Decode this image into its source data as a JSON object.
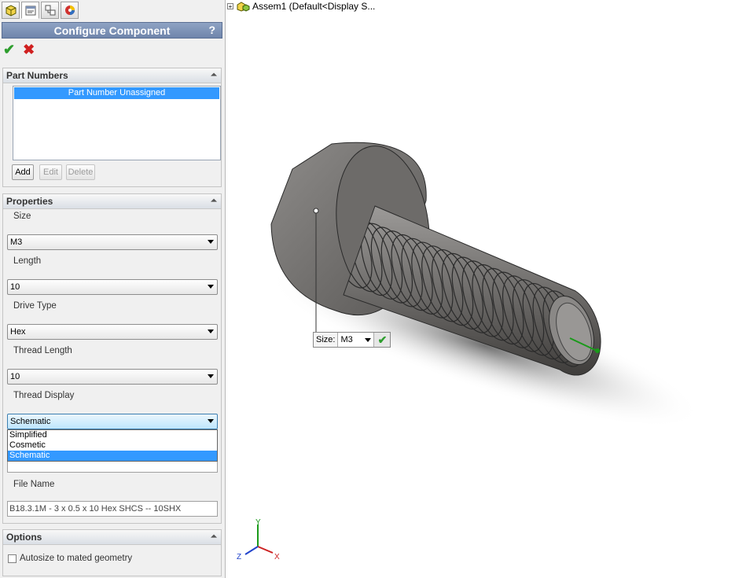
{
  "property_manager": {
    "title": "Configure Component",
    "help": "?",
    "ok_label": "✔",
    "cancel_label": "✖"
  },
  "part_numbers": {
    "header": "Part Numbers",
    "items": [
      "Part Number Unassigned"
    ],
    "add_label": "Add",
    "edit_label": "Edit",
    "delete_label": "Delete"
  },
  "properties": {
    "header": "Properties",
    "size_label": "Size",
    "size_value": "M3",
    "length_label": "Length",
    "length_value": "10",
    "drive_type_label": "Drive Type",
    "drive_type_value": "Hex",
    "thread_length_label": "Thread Length",
    "thread_length_value": "10",
    "thread_display_label": "Thread Display",
    "thread_display_value": "Schematic",
    "thread_display_options": [
      "Simplified",
      "Cosmetic",
      "Schematic"
    ],
    "file_name_label": "File Name",
    "file_name_value": "B18.3.1M - 3 x 0.5 x 10 Hex SHCS -- 10SHX"
  },
  "options": {
    "header": "Options",
    "autosize_label": "Autosize to mated geometry",
    "autosize_checked": false
  },
  "tree": {
    "expander": "+",
    "node_label": "Assem1  (Default<Display S..."
  },
  "callout": {
    "label": "Size:",
    "value": "M3"
  },
  "triad": {
    "x": "X",
    "y": "Y",
    "z": "Z"
  },
  "colors": {
    "selection": "#3399ff",
    "title_bar": "#7d92b6",
    "ok_green": "#2e9e2e",
    "cancel_red": "#d02020",
    "part_body": "#8a8886"
  }
}
